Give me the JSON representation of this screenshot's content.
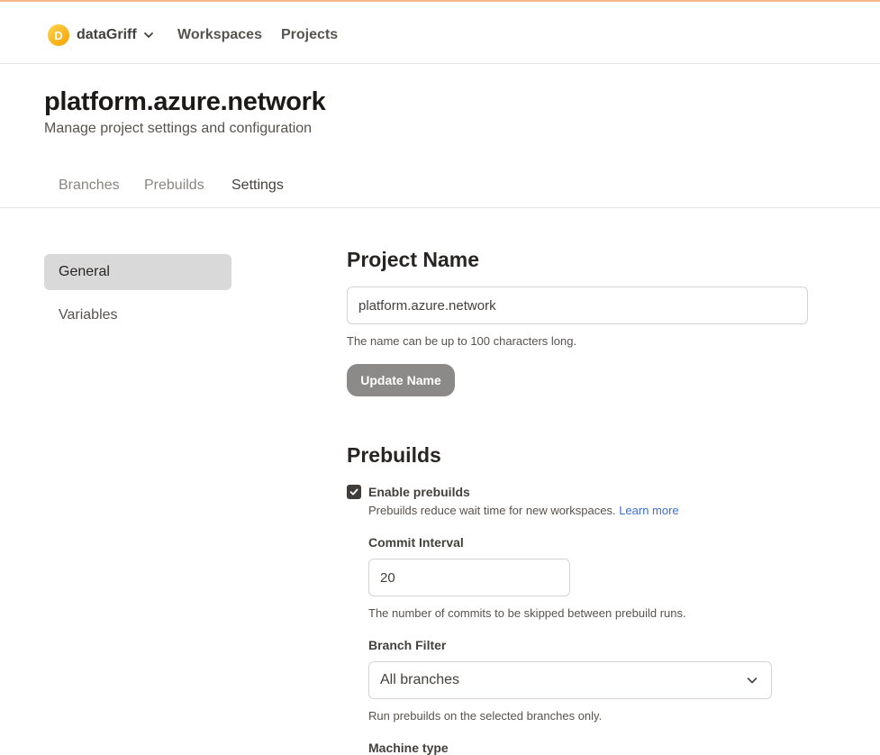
{
  "nav": {
    "org_initial": "D",
    "org_name": "dataGriff",
    "links": [
      "Workspaces",
      "Projects"
    ]
  },
  "header": {
    "title": "platform.azure.network",
    "subtitle": "Manage project settings and configuration"
  },
  "tabs": [
    {
      "label": "Branches",
      "active": false
    },
    {
      "label": "Prebuilds",
      "active": false
    },
    {
      "label": "Settings",
      "active": true
    }
  ],
  "sidebar": {
    "items": [
      {
        "label": "General",
        "active": true
      },
      {
        "label": "Variables",
        "active": false
      }
    ]
  },
  "project_name": {
    "heading": "Project Name",
    "value": "platform.azure.network",
    "hint": "The name can be up to 100 characters long.",
    "button": "Update Name"
  },
  "prebuilds": {
    "heading": "Prebuilds",
    "enable_label": "Enable prebuilds",
    "enabled": true,
    "description": "Prebuilds reduce wait time for new workspaces.",
    "learn_more": "Learn more",
    "commit_interval_label": "Commit Interval",
    "commit_interval_value": "20",
    "commit_interval_hint": "The number of commits to be skipped between prebuild runs.",
    "branch_filter_label": "Branch Filter",
    "branch_filter_value": "All branches",
    "branch_filter_hint": "Run prebuilds on the selected branches only.",
    "machine_type_label": "Machine type"
  },
  "colors": {
    "accent_line": "#f5b68a",
    "avatar": "#f5a300",
    "link": "#3b6fd8",
    "button": "#8c8a88",
    "active_menu": "#d9d9d9"
  },
  "icons": {
    "org_dropdown": "chevron-down-icon",
    "checkbox": "checkmark-icon",
    "select_dropdown": "chevron-down-icon"
  }
}
